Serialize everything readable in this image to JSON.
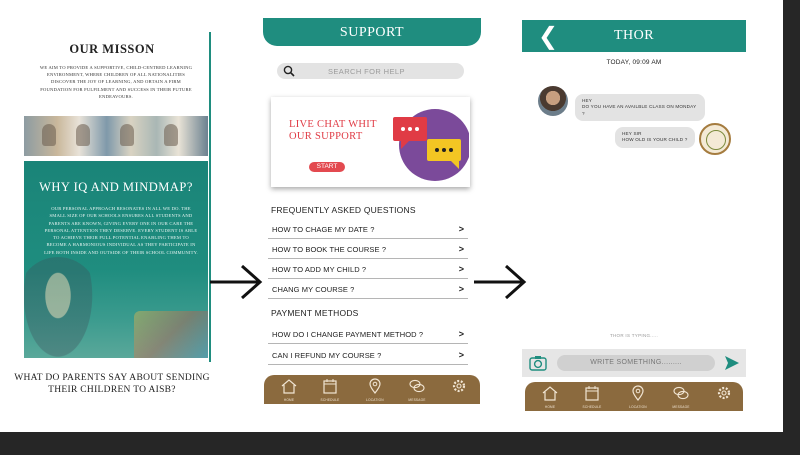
{
  "screen1": {
    "mission_title": "OUR MISSON",
    "mission_text": "WE AIM TO PROVIDE A SUPPORTIVE, CHILD-CENTRED LEARNING ENVIRONMENT, WHERE CHILDREN OF ALL NATIONALITIES DISCOVER THE JOY OF LEARNING, AND OBTAIN A FIRM FOUNDATION FOR FULFILMENT AND SUCCESS IN THEIR FUTURE ENDEAVOURS.",
    "panel_title": "WHY IQ AND MINDMAP?",
    "panel_text": "OUR PERSONAL APPROACH RESONATES IN ALL WE DO. THE SMALL SIZE OF OUR SCHOOLS ENSURES ALL STUDENTS AND PARENTS ARE KNOWN, GIVING EVERY ONE IN OUR CARE THE PERSONAL ATTENTION THEY DESERVE. EVERY STUDENT IS ABLE TO ACHIEVE THEIR FULL POTENTIAL ENABLING THEM TO BECOME A HARMONIOUS INDIVIDUAL AS THEY PARTICIPATE IN LIFE BOTH INSIDE AND OUTSIDE OF THEIR SCHOOL COMMUNITY.",
    "question": "WHAT DO PARENTS SAY ABOUT SENDING THEIR CHILDREN TO AISB?"
  },
  "screen2": {
    "title": "SUPPORT",
    "search_placeholder": "SEARCH FOR HELP",
    "card_text": "LIVE CHAT WHIT OUR SUPPORT",
    "start_label": "START",
    "faq_title": "FREQUENTLY ASKED QUESTIONS",
    "faq": [
      "HOW TO CHAGE MY DATE ?",
      "HOW TO BOOK THE COURSE ?",
      "HOW TO ADD MY CHILD ?",
      "CHANG MY COURSE ?"
    ],
    "payment_title": "PAYMENT METHODS",
    "payment": [
      "HOW DO I CHANGE PAYMENT METHOD ?",
      "CAN I REFUND MY COURSE ?"
    ]
  },
  "screen3": {
    "title": "THOR",
    "timestamp": "TODAY, 09:09 AM",
    "messages": [
      {
        "from": "user",
        "text": "HEY\nDO YOU HAVE AN AVAILBLE CLASS ON MONDAY ?"
      },
      {
        "from": "school",
        "text": "HEY SIR\nHOW OLD IS YOUR CHILD ?"
      }
    ],
    "typing": "THOR IS TYPING.....",
    "input_placeholder": "WRITE SOMETHING........."
  },
  "tabbar": {
    "tabs": [
      {
        "label": "HOME",
        "icon": "home-icon"
      },
      {
        "label": "SCHEDULE",
        "icon": "calendar-icon"
      },
      {
        "label": "LOCATION",
        "icon": "location-pin-icon"
      },
      {
        "label": "MESSAGE",
        "icon": "chat-icon"
      },
      {
        "label": "",
        "icon": "gear-icon"
      }
    ]
  },
  "colors": {
    "teal": "#1f8d7f",
    "brown": "#8b6a3e",
    "red": "#e03b45",
    "purple": "#7b4a9a",
    "yellow": "#f3c623"
  }
}
